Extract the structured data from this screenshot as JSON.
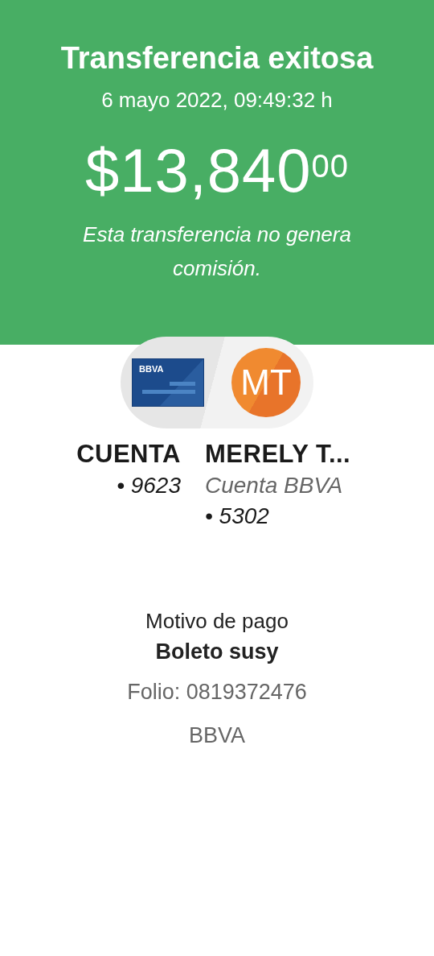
{
  "header": {
    "title": "Transferencia exitosa",
    "datetime": "6 mayo 2022, 09:49:32 h",
    "amount": "$13,840$^{00}$",
    "note": "Esta transferencia no genera comisión."
  },
  "origin": {
    "card_brand": "BBVA",
    "name": "CUENTA",
    "account": "• 9623"
  },
  "destination": {
    "initials": "MT",
    "name": "MERELY T...",
    "bank": "Cuenta BBVA",
    "account": "• 5302"
  },
  "details": {
    "label": "Motivo de pago",
    "value": "Boleto susy",
    "folio": "Folio: 0819372476",
    "bank": "BBVA"
  }
}
